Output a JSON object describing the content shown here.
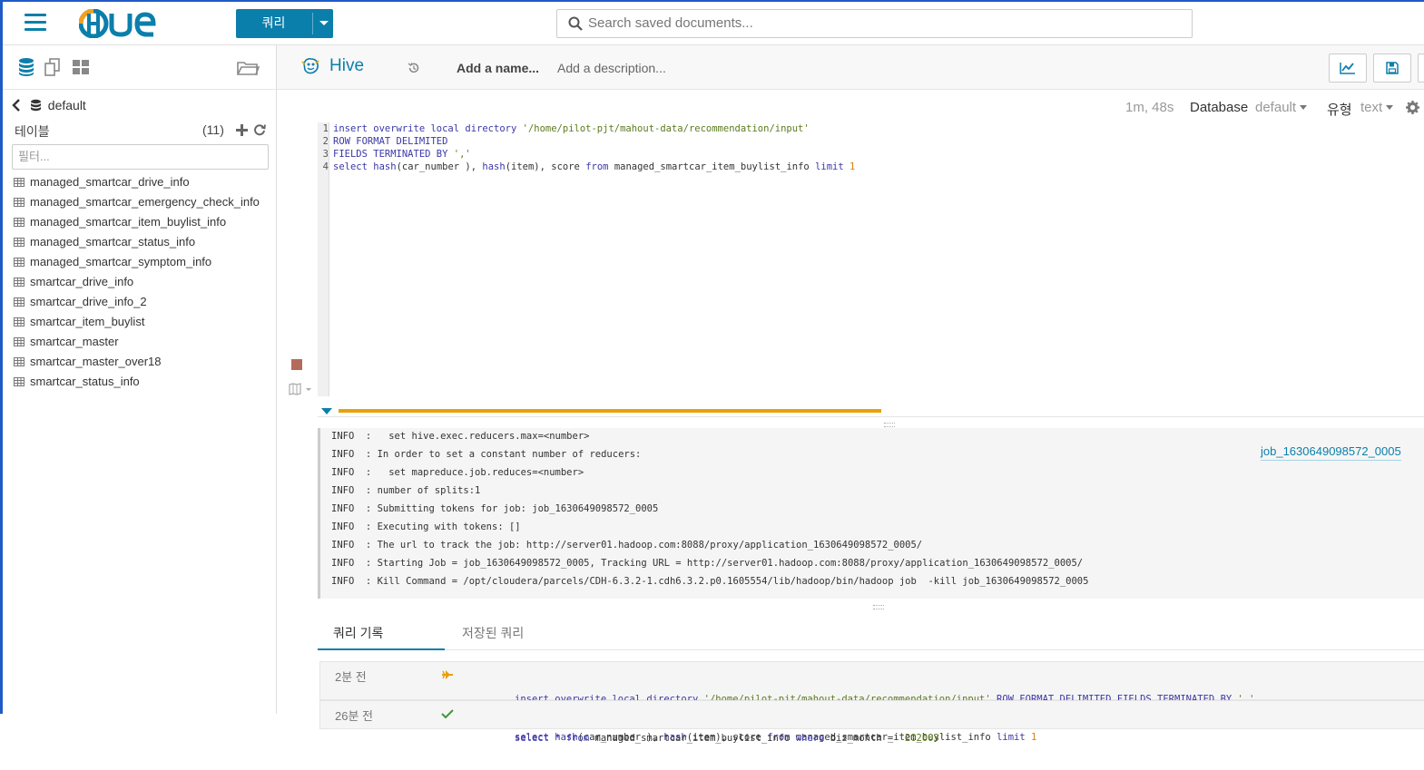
{
  "app": {
    "logo_text": "HUE"
  },
  "topbar": {
    "query_button_label": "쿼리",
    "search_placeholder": "Search saved documents..."
  },
  "left_panel": {
    "database": "default",
    "tables_label": "테이블",
    "tables_count": "(11)",
    "filter_placeholder": "필터...",
    "tables": [
      "managed_smartcar_drive_info",
      "managed_smartcar_emergency_check_info",
      "managed_smartcar_item_buylist_info",
      "managed_smartcar_status_info",
      "managed_smartcar_symptom_info",
      "smartcar_drive_info",
      "smartcar_drive_info_2",
      "smartcar_item_buylist",
      "smartcar_master",
      "smartcar_master_over18",
      "smartcar_status_info"
    ]
  },
  "editor": {
    "title": "Hive",
    "name_placeholder": "Add a name...",
    "description_placeholder": "Add a description...",
    "elapsed": "1m, 48s",
    "database_label": "Database",
    "database_value": "default",
    "type_label": "유형",
    "type_value": "text",
    "line_numbers": [
      "1",
      "2",
      "3",
      "4"
    ],
    "code": {
      "l1_kw": "insert overwrite local directory ",
      "l1_str": "'/home/pilot-pjt/mahout-data/recommendation/input'",
      "l2": "ROW FORMAT DELIMITED",
      "l3_kw": "FIELDS TERMINATED BY ",
      "l3_str": "','",
      "l4_a": "select ",
      "l4_b": "hash",
      "l4_c": "(car_number ), ",
      "l4_d": "hash",
      "l4_e": "(item), score ",
      "l4_f": "from",
      "l4_g": " managed_smartcar_item_buylist_info ",
      "l4_h": "limit",
      "l4_i": " 1"
    },
    "progress": 0.5
  },
  "log": {
    "lines": [
      "INFO  :   set hive.exec.reducers.max=<number>",
      "INFO  : In order to set a constant number of reducers:",
      "INFO  :   set mapreduce.job.reduces=<number>",
      "INFO  : number of splits:1",
      "INFO  : Submitting tokens for job: job_1630649098572_0005",
      "INFO  : Executing with tokens: []",
      "INFO  : The url to track the job: http://server01.hadoop.com:8088/proxy/application_1630649098572_0005/",
      "INFO  : Starting Job = job_1630649098572_0005, Tracking URL = http://server01.hadoop.com:8088/proxy/application_1630649098572_0005/",
      "INFO  : Kill Command = /opt/cloudera/parcels/CDH-6.3.2-1.cdh6.3.2.p0.1605554/lib/hadoop/bin/hadoop job  -kill job_1630649098572_0005"
    ],
    "job_link": "job_1630649098572_0005"
  },
  "tabs": {
    "history": "쿼리 기록",
    "saved": "저장된 쿼리"
  },
  "history": [
    {
      "time": "2분 전",
      "q1_kw": "insert overwrite local directory ",
      "q1_str": "'/home/pilot-pjt/mahout-data/recommendation/input'",
      "q1_kw2": " ROW FORMAT DELIMITED FIELDS TERMINATED BY ",
      "q1_str2": "','",
      "q2_a": "select ",
      "q2_b": "hash",
      "q2_c": "(car_number ), ",
      "q2_d": "hash",
      "q2_e": "(item), score ",
      "q2_f": "from",
      "q2_g": " managed_smartcar_item_buylist_info ",
      "q2_h": "limit",
      "q2_i": " 1"
    },
    {
      "time": "26분 전",
      "q1_a": "select * ",
      "q1_b": "from",
      "q1_c": " managed_smartcar_item_buylist_info ",
      "q1_d": "where",
      "q1_e": " biz_month = ",
      "q1_f": "'202003'"
    }
  ],
  "colors": {
    "brand": "#0b7fab",
    "progress": "#e8a10a",
    "keyword": "#3b37a7",
    "string": "#5c7a1e",
    "number": "#d9820e"
  }
}
